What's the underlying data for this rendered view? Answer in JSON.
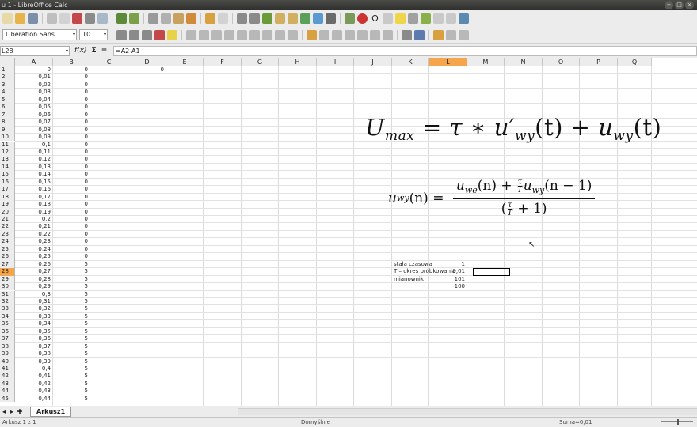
{
  "window": {
    "title": "u 1 - LibreOffice Calc",
    "controls": [
      "−",
      "□",
      "×"
    ]
  },
  "toolbar2": {
    "font_name": "Liberation Sans",
    "font_size": "10"
  },
  "formula_bar": {
    "cell_ref": "L28",
    "function_wizard": "f(x)",
    "sum_symbol": "Σ",
    "equals_symbol": "=",
    "formula": "=A2-A1"
  },
  "columns": [
    "A",
    "B",
    "C",
    "D",
    "E",
    "F",
    "G",
    "H",
    "I",
    "J",
    "K",
    "L",
    "M",
    "N",
    "O",
    "P",
    "Q"
  ],
  "selected_column": "L",
  "selected_row": "28",
  "rows": [
    {
      "n": "1",
      "a": "0",
      "b": "0",
      "c": "0"
    },
    {
      "n": "2",
      "a": "0,01",
      "b": "0"
    },
    {
      "n": "3",
      "a": "0,02",
      "b": "0"
    },
    {
      "n": "4",
      "a": "0,03",
      "b": "0"
    },
    {
      "n": "5",
      "a": "0,04",
      "b": "0"
    },
    {
      "n": "6",
      "a": "0,05",
      "b": "0"
    },
    {
      "n": "7",
      "a": "0,06",
      "b": "0"
    },
    {
      "n": "8",
      "a": "0,07",
      "b": "0"
    },
    {
      "n": "9",
      "a": "0,08",
      "b": "0"
    },
    {
      "n": "10",
      "a": "0,09",
      "b": "0"
    },
    {
      "n": "11",
      "a": "0,1",
      "b": "0"
    },
    {
      "n": "12",
      "a": "0,11",
      "b": "0"
    },
    {
      "n": "13",
      "a": "0,12",
      "b": "0"
    },
    {
      "n": "14",
      "a": "0,13",
      "b": "0"
    },
    {
      "n": "15",
      "a": "0,14",
      "b": "0"
    },
    {
      "n": "16",
      "a": "0,15",
      "b": "0"
    },
    {
      "n": "17",
      "a": "0,16",
      "b": "0"
    },
    {
      "n": "18",
      "a": "0,17",
      "b": "0"
    },
    {
      "n": "19",
      "a": "0,18",
      "b": "0"
    },
    {
      "n": "20",
      "a": "0,19",
      "b": "0"
    },
    {
      "n": "21",
      "a": "0,2",
      "b": "0"
    },
    {
      "n": "22",
      "a": "0,21",
      "b": "0"
    },
    {
      "n": "23",
      "a": "0,22",
      "b": "0"
    },
    {
      "n": "24",
      "a": "0,23",
      "b": "0"
    },
    {
      "n": "25",
      "a": "0,24",
      "b": "0"
    },
    {
      "n": "26",
      "a": "0,25",
      "b": "0"
    },
    {
      "n": "27",
      "a": "0,26",
      "b": "5",
      "k": "stała czasowa",
      "l": "1"
    },
    {
      "n": "28",
      "a": "0,27",
      "b": "5",
      "k": "T – okres próbkowania",
      "l": "0,01"
    },
    {
      "n": "29",
      "a": "0,28",
      "b": "5",
      "k": "mianownik",
      "l": "101"
    },
    {
      "n": "30",
      "a": "0,29",
      "b": "5",
      "l": "100"
    },
    {
      "n": "31",
      "a": "0,3",
      "b": "5"
    },
    {
      "n": "32",
      "a": "0,31",
      "b": "5"
    },
    {
      "n": "33",
      "a": "0,32",
      "b": "5"
    },
    {
      "n": "34",
      "a": "0,33",
      "b": "5"
    },
    {
      "n": "35",
      "a": "0,34",
      "b": "5"
    },
    {
      "n": "36",
      "a": "0,35",
      "b": "5"
    },
    {
      "n": "37",
      "a": "0,36",
      "b": "5"
    },
    {
      "n": "38",
      "a": "0,37",
      "b": "5"
    },
    {
      "n": "39",
      "a": "0,38",
      "b": "5"
    },
    {
      "n": "40",
      "a": "0,39",
      "b": "5"
    },
    {
      "n": "41",
      "a": "0,4",
      "b": "5"
    },
    {
      "n": "42",
      "a": "0,41",
      "b": "5"
    },
    {
      "n": "43",
      "a": "0,42",
      "b": "5"
    },
    {
      "n": "44",
      "a": "0,43",
      "b": "5"
    },
    {
      "n": "45",
      "a": "0,44",
      "b": "5"
    }
  ],
  "equations": {
    "eq1": {
      "lhs": "U",
      "lhs_sub": "max",
      "eq": " = ",
      "tau": "τ",
      "star": " ∗ ",
      "u1": "u′",
      "u1_sub": "wy",
      "t1": "(t)",
      "plus": " + ",
      "u2": "u",
      "u2_sub": "wy",
      "t2": "(t)"
    },
    "eq2": {
      "lhs": "u",
      "lhs_sub": "wy",
      "lhs_arg": "(n) = ",
      "n_u": "u",
      "n_u_sub": "we",
      "n_arg": "(n) + ",
      "tau": "τ",
      "T": "T",
      "n_u2": "u",
      "n_u2_sub": "wy",
      "n_arg2": "(n − 1)",
      "d_open": "(",
      "d_close": " + 1)"
    }
  },
  "sheet_tabs": {
    "active": "Arkusz1",
    "nav": [
      "◂",
      "▸",
      "✚"
    ]
  },
  "status": {
    "sheet_info": "Arkusz 1 z 1",
    "page_style": "Domyślnie",
    "sum": "Suma=0,01"
  },
  "colors": {
    "selection_accent": "#f5a54b",
    "titlebar": "#3a3a38"
  }
}
